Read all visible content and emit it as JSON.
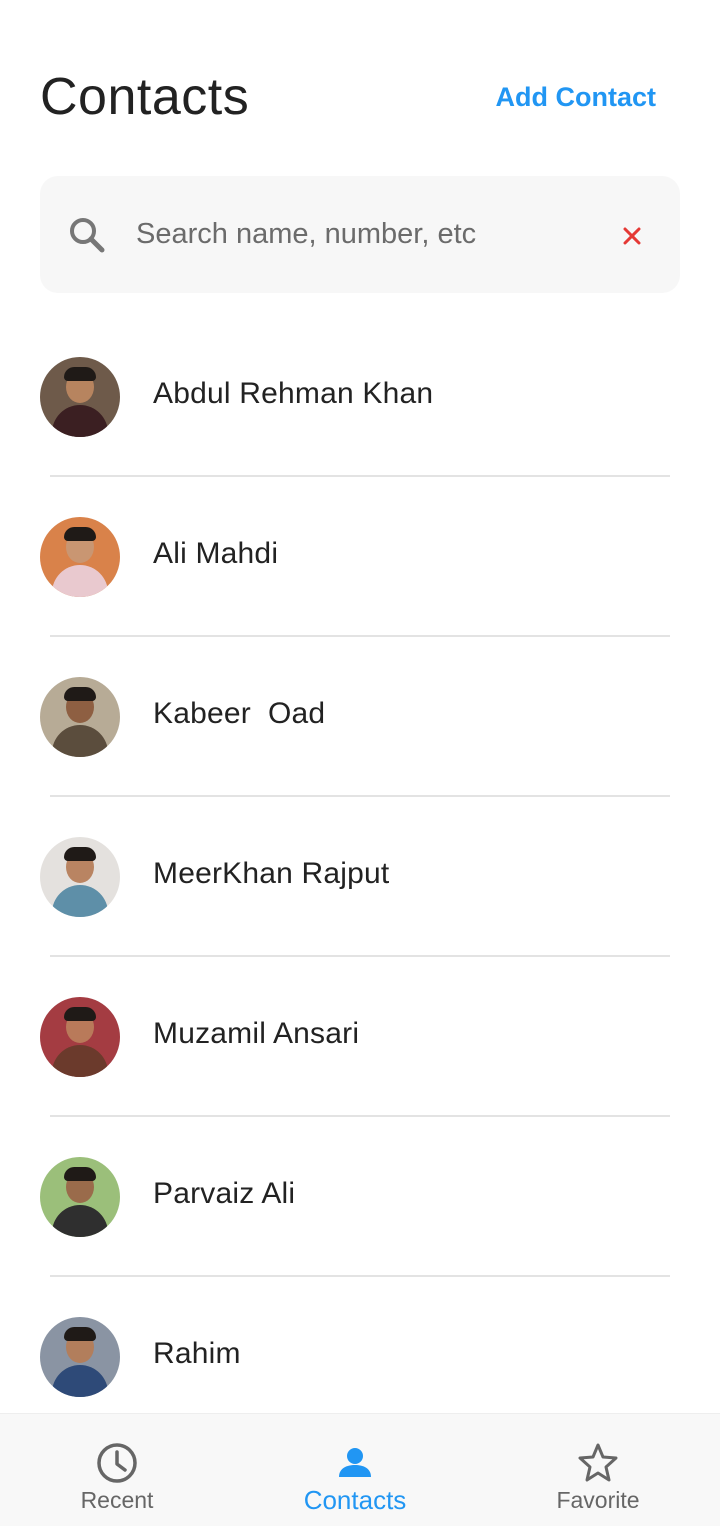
{
  "header": {
    "title": "Contacts",
    "add_contact_label": "Add Contact"
  },
  "search": {
    "placeholder": "Search name, number, etc",
    "value": "",
    "search_icon": "search-icon",
    "clear_icon": "close-icon"
  },
  "contacts": [
    {
      "name": "Abdul Rehman Khan",
      "avatar_bg": "#6e5a4a",
      "shirt": "#3b1f22",
      "skin": "#b7845f"
    },
    {
      "name": "Ali Mahdi",
      "avatar_bg": "#d9824a",
      "shirt": "#e9c9cf",
      "skin": "#c99672"
    },
    {
      "name": "Kabeer  Oad",
      "avatar_bg": "#b7ab96",
      "shirt": "#5b4d3d",
      "skin": "#8e5f42"
    },
    {
      "name": "MeerKhan Rajput",
      "avatar_bg": "#e4e1de",
      "shirt": "#5e8fa8",
      "skin": "#b98462"
    },
    {
      "name": "Muzamil Ansari",
      "avatar_bg": "#a43c42",
      "shirt": "#6b3a2c",
      "skin": "#b97a5a"
    },
    {
      "name": "Parvaiz Ali",
      "avatar_bg": "#9bbf7a",
      "shirt": "#2f2f2f",
      "skin": "#9a6b4b"
    },
    {
      "name": "Rahim",
      "avatar_bg": "#8a94a3",
      "shirt": "#2e4a78",
      "skin": "#b27e5c"
    }
  ],
  "bottom_nav": [
    {
      "label": "Recent",
      "icon": "clock-icon",
      "active": false
    },
    {
      "label": "Contacts",
      "icon": "person-icon",
      "active": true
    },
    {
      "label": "Favorite",
      "icon": "star-icon",
      "active": false
    }
  ],
  "colors": {
    "accent": "#2196F3",
    "clear_icon": "#e53935",
    "search_bg": "#f7f7f7",
    "divider": "#e3e3e3"
  }
}
